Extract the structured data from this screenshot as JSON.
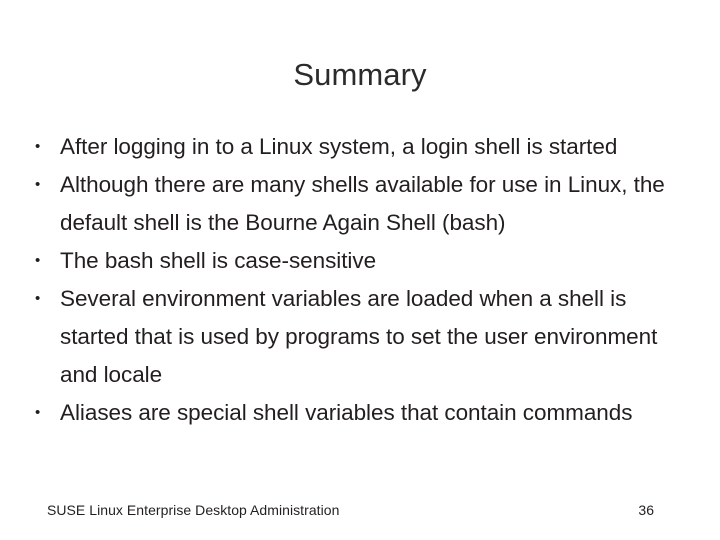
{
  "slide": {
    "title": "Summary",
    "bullet_marker": "•",
    "bullets": [
      {
        "text": "After logging in to a Linux system, a login shell is started"
      },
      {
        "text": "Although there are many shells available for use in Linux, the default shell is the Bourne Again Shell (bash)"
      },
      {
        "text": "The bash shell is case-sensitive"
      },
      {
        "text": "Several environment variables are loaded when a shell is started that is used by programs to set the user environment and locale"
      },
      {
        "text": "Aliases are special shell variables that contain commands"
      }
    ]
  },
  "footer": {
    "title": "SUSE Linux Enterprise Desktop Administration",
    "page_number": "36"
  },
  "colors": {
    "background": "#ffffff",
    "text": "#231f20",
    "title_text": "#2b2b2b"
  }
}
